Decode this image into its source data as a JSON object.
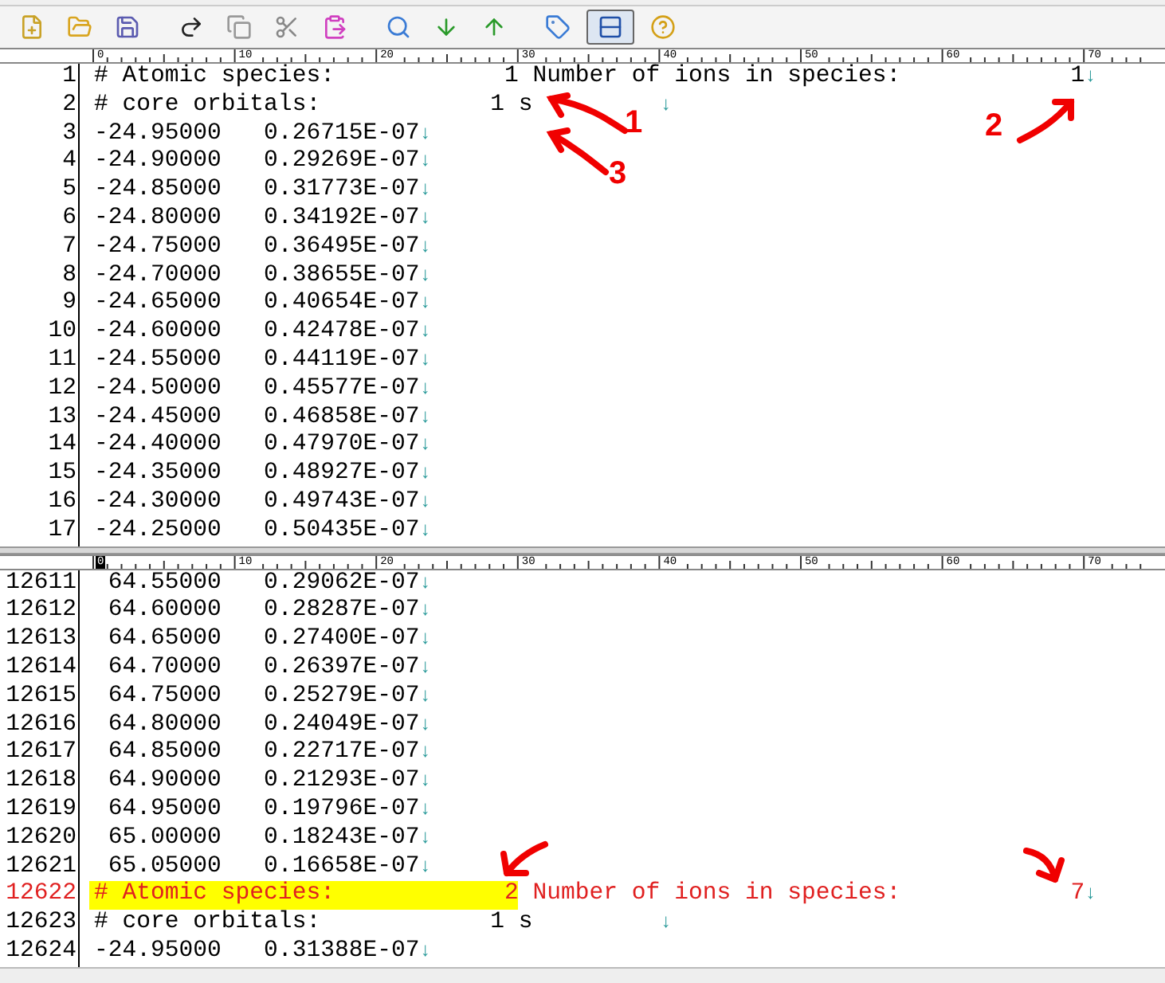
{
  "toolbar": [
    {
      "kind": "new",
      "pressed": false
    },
    {
      "kind": "open",
      "pressed": false
    },
    {
      "kind": "save",
      "pressed": false
    },
    {
      "kind": "redo",
      "pressed": false
    },
    {
      "kind": "copy",
      "pressed": false
    },
    {
      "kind": "cut",
      "pressed": false
    },
    {
      "kind": "paste",
      "pressed": false
    },
    {
      "kind": "search",
      "pressed": false
    },
    {
      "kind": "find_next",
      "pressed": false
    },
    {
      "kind": "find_prev",
      "pressed": false
    },
    {
      "kind": "tag",
      "pressed": false
    },
    {
      "kind": "split",
      "pressed": true
    },
    {
      "kind": "help",
      "pressed": false
    }
  ],
  "panes": [
    {
      "ruler": {
        "labels": [
          "0",
          "10",
          "20",
          "30",
          "40",
          "50",
          "60",
          "70"
        ],
        "cursor_marked": false
      },
      "lines": [
        {
          "number": "1",
          "text": "# Atomic species:            1 Number of ions in species:            1",
          "eol_mark": "↓",
          "current": false
        },
        {
          "number": "2",
          "text": "# core orbitals:            1 s         ",
          "eol_mark": "↓",
          "current": false
        },
        {
          "number": "3",
          "text": "-24.95000   0.26715E-07",
          "eol_mark": "↓",
          "current": false
        },
        {
          "number": "4",
          "text": "-24.90000   0.29269E-07",
          "eol_mark": "↓",
          "current": false
        },
        {
          "number": "5",
          "text": "-24.85000   0.31773E-07",
          "eol_mark": "↓",
          "current": false
        },
        {
          "number": "6",
          "text": "-24.80000   0.34192E-07",
          "eol_mark": "↓",
          "current": false
        },
        {
          "number": "7",
          "text": "-24.75000   0.36495E-07",
          "eol_mark": "↓",
          "current": false
        },
        {
          "number": "8",
          "text": "-24.70000   0.38655E-07",
          "eol_mark": "↓",
          "current": false
        },
        {
          "number": "9",
          "text": "-24.65000   0.40654E-07",
          "eol_mark": "↓",
          "current": false
        },
        {
          "number": "10",
          "text": "-24.60000   0.42478E-07",
          "eol_mark": "↓",
          "current": false
        },
        {
          "number": "11",
          "text": "-24.55000   0.44119E-07",
          "eol_mark": "↓",
          "current": false
        },
        {
          "number": "12",
          "text": "-24.50000   0.45577E-07",
          "eol_mark": "↓",
          "current": false
        },
        {
          "number": "13",
          "text": "-24.45000   0.46858E-07",
          "eol_mark": "↓",
          "current": false
        },
        {
          "number": "14",
          "text": "-24.40000   0.47970E-07",
          "eol_mark": "↓",
          "current": false
        },
        {
          "number": "15",
          "text": "-24.35000   0.48927E-07",
          "eol_mark": "↓",
          "current": false
        },
        {
          "number": "16",
          "text": "-24.30000   0.49743E-07",
          "eol_mark": "↓",
          "current": false
        },
        {
          "number": "17",
          "text": "-24.25000   0.50435E-07",
          "eol_mark": "↓",
          "current": false
        }
      ]
    },
    {
      "ruler": {
        "labels": [
          "0",
          "10",
          "20",
          "30",
          "40",
          "50",
          "60",
          "70"
        ],
        "cursor_marked": true
      },
      "lines": [
        {
          "number": "12611",
          "text": " 64.55000   0.29062E-07",
          "eol_mark": "↓",
          "current": false
        },
        {
          "number": "12612",
          "text": " 64.60000   0.28287E-07",
          "eol_mark": "↓",
          "current": false
        },
        {
          "number": "12613",
          "text": " 64.65000   0.27400E-07",
          "eol_mark": "↓",
          "current": false
        },
        {
          "number": "12614",
          "text": " 64.70000   0.26397E-07",
          "eol_mark": "↓",
          "current": false
        },
        {
          "number": "12615",
          "text": " 64.75000   0.25279E-07",
          "eol_mark": "↓",
          "current": false
        },
        {
          "number": "12616",
          "text": " 64.80000   0.24049E-07",
          "eol_mark": "↓",
          "current": false
        },
        {
          "number": "12617",
          "text": " 64.85000   0.22717E-07",
          "eol_mark": "↓",
          "current": false
        },
        {
          "number": "12618",
          "text": " 64.90000   0.21293E-07",
          "eol_mark": "↓",
          "current": false
        },
        {
          "number": "12619",
          "text": " 64.95000   0.19796E-07",
          "eol_mark": "↓",
          "current": false
        },
        {
          "number": "12620",
          "text": " 65.00000   0.18243E-07",
          "eol_mark": "↓",
          "current": false
        },
        {
          "number": "12621",
          "text": " 65.05000   0.16658E-07",
          "eol_mark": "↓",
          "current": false
        },
        {
          "number": "12622",
          "highlighted_text": "# Atomic species:            2",
          "text": " Number of ions in species:            7",
          "eol_mark": "↓",
          "current": true
        },
        {
          "number": "12623",
          "text": "# core orbitals:            1 s         ",
          "eol_mark": "↓",
          "current": false
        },
        {
          "number": "12624",
          "text": "-24.95000   0.31388E-07",
          "eol_mark": "↓",
          "current": false
        }
      ]
    }
  ],
  "annotations": [
    {
      "label": "1"
    },
    {
      "label": "2"
    },
    {
      "label": "3"
    }
  ]
}
